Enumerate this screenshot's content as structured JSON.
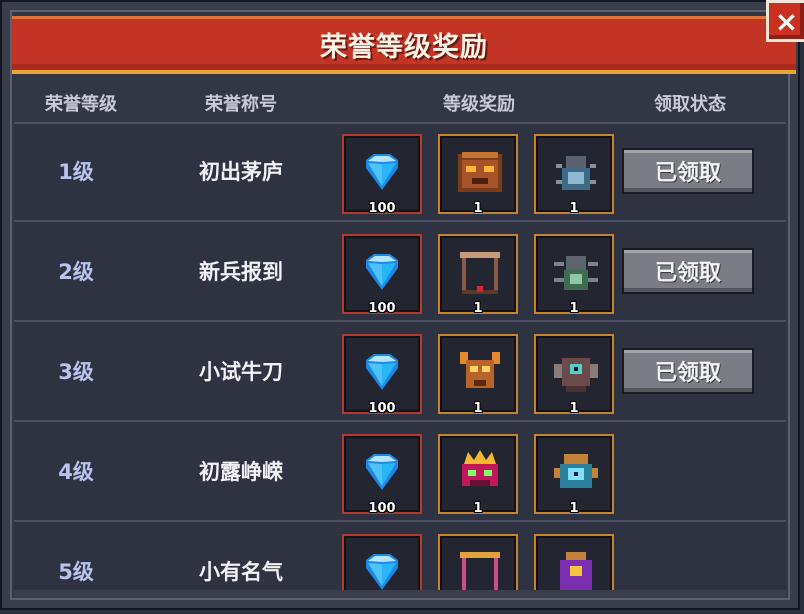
{
  "title": "荣誉等级奖励",
  "close_label": "×",
  "headers": {
    "level": "荣誉等级",
    "title": "荣誉称号",
    "rewards": "等级奖励",
    "status": "领取状态"
  },
  "rows": [
    {
      "level": "1级",
      "title": "初出茅庐",
      "rewards": [
        {
          "item": "gem-icon",
          "qty": "100"
        },
        {
          "item": "lion-helmet-skin-icon",
          "qty": "1"
        },
        {
          "item": "beetle-pet-icon",
          "qty": "1"
        }
      ],
      "status": "已领取"
    },
    {
      "level": "2级",
      "title": "新兵报到",
      "rewards": [
        {
          "item": "gem-icon",
          "qty": "100"
        },
        {
          "item": "frame-skin-icon",
          "qty": "1"
        },
        {
          "item": "spider-pet-icon",
          "qty": "1"
        }
      ],
      "status": "已领取"
    },
    {
      "level": "3级",
      "title": "小试牛刀",
      "rewards": [
        {
          "item": "gem-icon",
          "qty": "100"
        },
        {
          "item": "horned-mask-skin-icon",
          "qty": "1"
        },
        {
          "item": "cyclops-pet-icon",
          "qty": "1"
        }
      ],
      "status": "已领取"
    },
    {
      "level": "4级",
      "title": "初露峥嵘",
      "rewards": [
        {
          "item": "gem-icon",
          "qty": "100"
        },
        {
          "item": "crown-demon-skin-icon",
          "qty": "1"
        },
        {
          "item": "eye-orb-pet-icon",
          "qty": "1"
        }
      ],
      "status": ""
    },
    {
      "level": "5级",
      "title": "小有名气",
      "rewards": [
        {
          "item": "gem-icon",
          "qty": ""
        },
        {
          "item": "frame-skin-icon",
          "qty": ""
        },
        {
          "item": "purple-orb-pet-icon",
          "qty": ""
        }
      ],
      "status": ""
    }
  ],
  "colors": {
    "title_bar": "#c33424",
    "gem": "#4fc3f7",
    "claimed_button": "#7b7d86",
    "slot_red": "#b33a2f",
    "slot_gold": "#c2822e"
  }
}
